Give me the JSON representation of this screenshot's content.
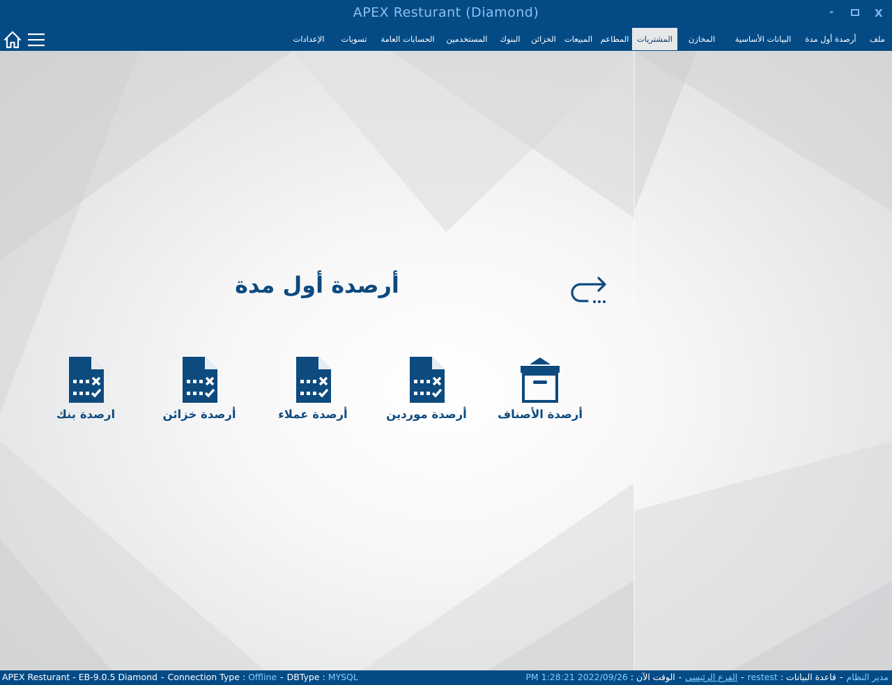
{
  "window": {
    "title": "APEX Resturant (Diamond)",
    "minimize": "-",
    "close": "X"
  },
  "menu": {
    "items": [
      {
        "label": "ملف"
      },
      {
        "label": "أرصدة أول مدة"
      },
      {
        "label": "البيانات الأساسية"
      },
      {
        "label": "المخازن"
      },
      {
        "label": "المشتريات",
        "active": true
      },
      {
        "label": "المطاعم"
      },
      {
        "label": "المبيعات"
      },
      {
        "label": "الخزائن"
      },
      {
        "label": "البنوك"
      },
      {
        "label": "المستخدمين"
      },
      {
        "label": "الحسابات العامة"
      },
      {
        "label": "تسويات"
      },
      {
        "label": "الإعدادات"
      }
    ]
  },
  "page": {
    "title": "أرصدة أول مدة"
  },
  "tiles": [
    {
      "label": "أرصدة الأصناف",
      "icon": "box-icon"
    },
    {
      "label": "أرصدة موردين",
      "icon": "document-checklist-icon"
    },
    {
      "label": "أرصدة عملاء",
      "icon": "document-checklist-icon"
    },
    {
      "label": "أرصدة خزائن",
      "icon": "document-checklist-icon"
    },
    {
      "label": "ارصدة بنك",
      "icon": "document-checklist-icon"
    }
  ],
  "status": {
    "app_version": "APEX Resturant - EB-9.0.5  Diamond",
    "connection_label": "Connection Type :",
    "connection_value": "Offline",
    "dbtype_label": "DBType :",
    "dbtype_value": "MYSQL",
    "user_label": "مدير النظام",
    "database_label": "قاعدة البيانات :",
    "database_value": "restest",
    "branch_value": "الفرع الرئيسي",
    "time_label": "الوقت الآن :",
    "time_value": "PM 1:28:21 2022/09/26",
    "separator": "-"
  },
  "colors": {
    "primary": "#044b86",
    "accent_text": "#0d4a7e",
    "status_value": "#7fd0ff"
  }
}
